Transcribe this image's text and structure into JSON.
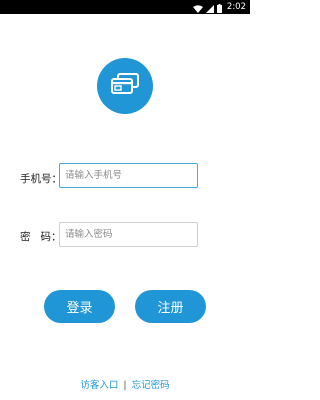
{
  "status_bar": {
    "time": "2:02",
    "icons": [
      "wifi-icon",
      "signal-icon",
      "battery-icon"
    ]
  },
  "logo": {
    "icon": "card-icon",
    "color": "#2196d6"
  },
  "form": {
    "phone_label": "手机号：",
    "phone_placeholder": "请输入手机号",
    "password_label": "密   码：",
    "password_placeholder": "请输入密码"
  },
  "buttons": {
    "login": "登录",
    "register": "注册"
  },
  "links": {
    "guest": "访客入口",
    "separator": "|",
    "forgot": "忘记密码"
  },
  "colors": {
    "accent": "#2196d6",
    "status_bar": "#000000"
  }
}
